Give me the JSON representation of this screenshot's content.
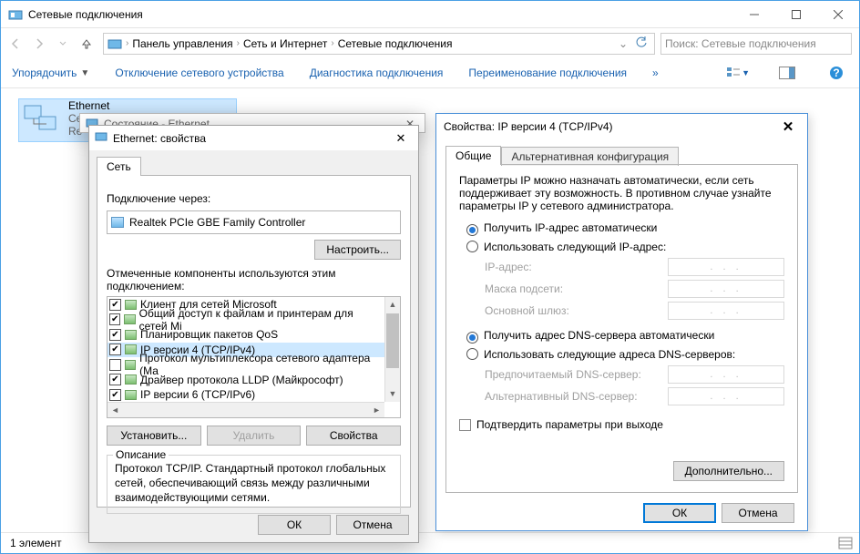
{
  "explorer": {
    "title": "Сетевые подключения",
    "breadcrumb": [
      "Панель управления",
      "Сеть и Интернет",
      "Сетевые подключения"
    ],
    "search_placeholder": "Поиск: Сетевые подключения",
    "commands": {
      "organize": "Упорядочить",
      "disable": "Отключение сетевого устройства",
      "diagnose": "Диагностика подключения",
      "rename": "Переименование подключения"
    },
    "item": {
      "name": "Ethernet",
      "line2": "Се",
      "line3": "Re"
    },
    "status_text": "1 элемент"
  },
  "status_dlg": {
    "title": "Состояние - Ethernet"
  },
  "prop_dlg": {
    "title": "Ethernet: свойства",
    "tab": "Сеть",
    "connect_via": "Подключение через:",
    "adapter": "Realtek PCIe GBE Family Controller",
    "configure": "Настроить...",
    "components_label": "Отмеченные компоненты используются этим подключением:",
    "components": [
      {
        "checked": true,
        "label": "Клиент для сетей Microsoft"
      },
      {
        "checked": true,
        "label": "Общий доступ к файлам и принтерам для сетей Mi"
      },
      {
        "checked": true,
        "label": "Планировщик пакетов QoS"
      },
      {
        "checked": true,
        "label": "IP версии 4 (TCP/IPv4)",
        "selected": true
      },
      {
        "checked": false,
        "label": "Протокол мультиплексора сетевого адаптера (Ма"
      },
      {
        "checked": true,
        "label": "Драйвер протокола LLDP (Майкрософт)"
      },
      {
        "checked": true,
        "label": "IP версии 6 (TCP/IPv6)"
      }
    ],
    "install": "Установить...",
    "uninstall": "Удалить",
    "properties": "Свойства",
    "desc_title": "Описание",
    "desc": "Протокол TCP/IP. Стандартный протокол глобальных сетей, обеспечивающий связь между различными взаимодействующими сетями.",
    "ok": "ОК",
    "cancel": "Отмена"
  },
  "ip_dlg": {
    "title": "Свойства: IP версии 4 (TCP/IPv4)",
    "tab_general": "Общие",
    "tab_alt": "Альтернативная конфигурация",
    "para": "Параметры IP можно назначать автоматически, если сеть поддерживает эту возможность. В противном случае узнайте параметры IP у сетевого администратора.",
    "r_ip_auto": "Получить IP-адрес автоматически",
    "r_ip_manual": "Использовать следующий IP-адрес:",
    "f_ip": "IP-адрес:",
    "f_mask": "Маска подсети:",
    "f_gw": "Основной шлюз:",
    "r_dns_auto": "Получить адрес DNS-сервера автоматически",
    "r_dns_manual": "Использовать следующие адреса DNS-серверов:",
    "f_dns1": "Предпочитаемый DNS-сервер:",
    "f_dns2": "Альтернативный DNS-сервер:",
    "chk_validate": "Подтвердить параметры при выходе",
    "advanced": "Дополнительно...",
    "ok": "ОК",
    "cancel": "Отмена",
    "ip_placeholder": ".   .   ."
  }
}
